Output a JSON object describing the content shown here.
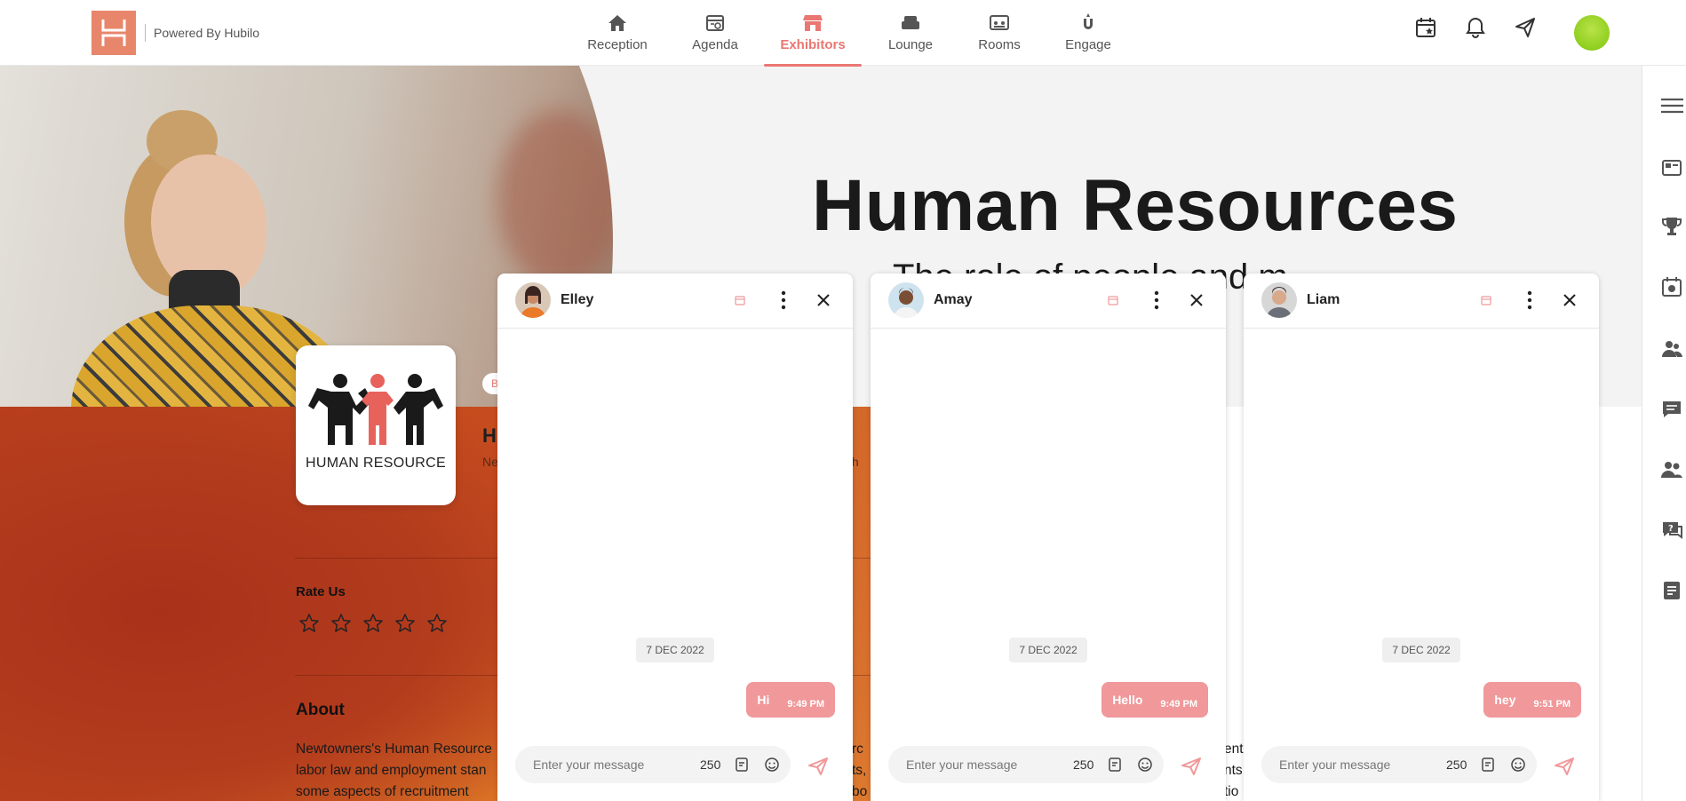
{
  "app": {
    "powered_by": "Powered By Hubilo"
  },
  "nav": {
    "items": [
      {
        "label": "Reception",
        "icon": "home-icon"
      },
      {
        "label": "Agenda",
        "icon": "agenda-icon"
      },
      {
        "label": "Exhibitors",
        "icon": "store-icon",
        "active": true
      },
      {
        "label": "Lounge",
        "icon": "sofa-icon"
      },
      {
        "label": "Rooms",
        "icon": "rooms-icon"
      },
      {
        "label": "Engage",
        "icon": "engage-icon"
      }
    ],
    "active_color": "#ea7772"
  },
  "top_actions": [
    "calendar-star-icon",
    "bell-icon",
    "send-icon",
    "profile-avatar"
  ],
  "right_rail": [
    "hamburger-menu-icon",
    "card-icon",
    "trophy-icon",
    "camera-calendar-icon",
    "people-icon",
    "chat-icon",
    "group-icon",
    "help-chat-icon",
    "notes-icon"
  ],
  "booth": {
    "banner_title": "Human Resources",
    "banner_subtitle": "The role of people and m",
    "logo_text": "HUMAN RESOURCE",
    "chip": "B",
    "name_fragment": "H",
    "location_fragment": "Ne",
    "mid_fragment": "th",
    "rate_label": "Rate Us",
    "rating_stars": 5,
    "rating_value": 0,
    "about_label": "About",
    "about_lines": [
      "Newtowners's Human Resource",
      "labor law and employment stan",
      "some aspects of recruitment"
    ],
    "right_fragments": [
      "rc",
      "ts,",
      "bo",
      "ent",
      "nts",
      "tio"
    ]
  },
  "chats": [
    {
      "name": "Elley",
      "date": "7 DEC 2022",
      "message": "Hi",
      "time": "9:49 PM",
      "placeholder": "Enter your message",
      "char_count": "250"
    },
    {
      "name": "Amay",
      "date": "7 DEC 2022",
      "message": "Hello",
      "time": "9:49 PM",
      "placeholder": "Enter your message",
      "char_count": "250"
    },
    {
      "name": "Liam",
      "date": "7 DEC 2022",
      "message": "hey",
      "time": "9:51 PM",
      "placeholder": "Enter your message",
      "char_count": "250"
    }
  ],
  "colors": {
    "brand": "#e8866b",
    "bubble": "#f0989a",
    "hero_bg": "#f3f3f3",
    "orange_bg": "#c9501f"
  }
}
